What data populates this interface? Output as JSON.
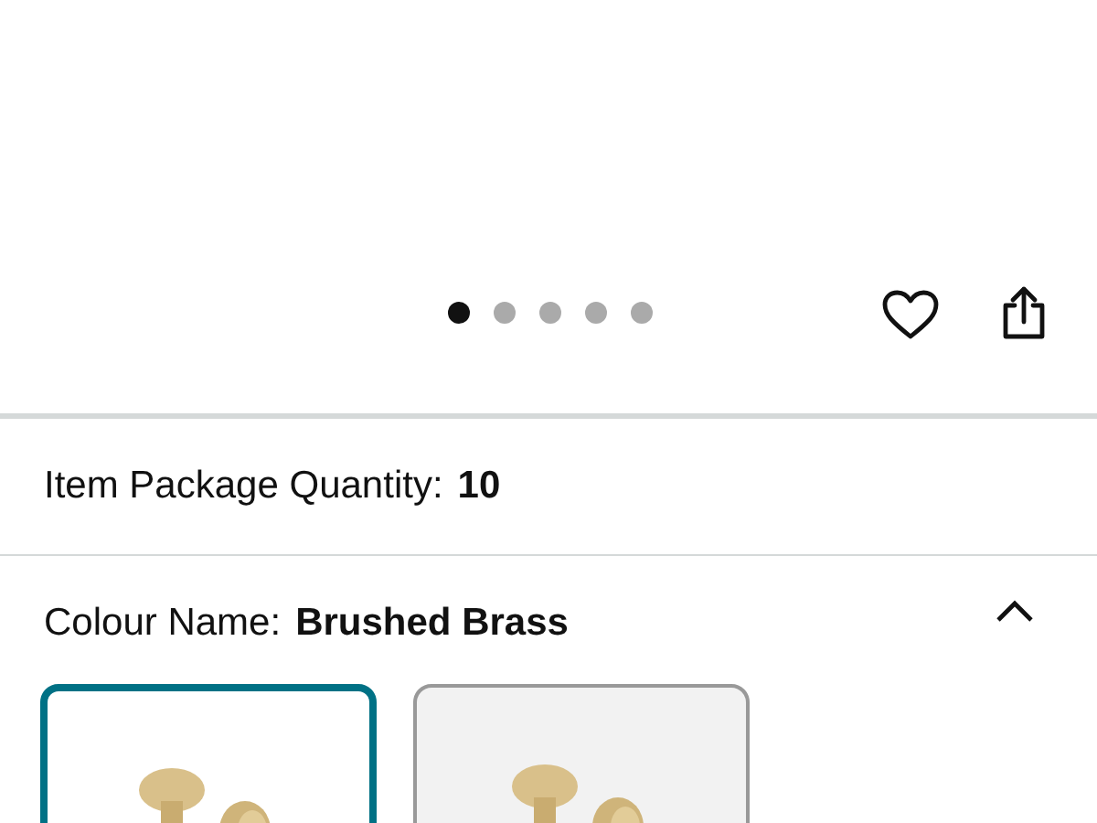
{
  "carousel": {
    "dots": [
      {
        "selected": true
      },
      {
        "selected": false
      },
      {
        "selected": false
      },
      {
        "selected": false
      },
      {
        "selected": false
      }
    ]
  },
  "package_quantity": {
    "label": "Item Package Quantity:",
    "value": "10"
  },
  "colour": {
    "label": "Colour Name:",
    "value": "Brushed Brass",
    "expanded": true
  },
  "swatches": [
    {
      "selected": true
    },
    {
      "selected": false
    }
  ]
}
